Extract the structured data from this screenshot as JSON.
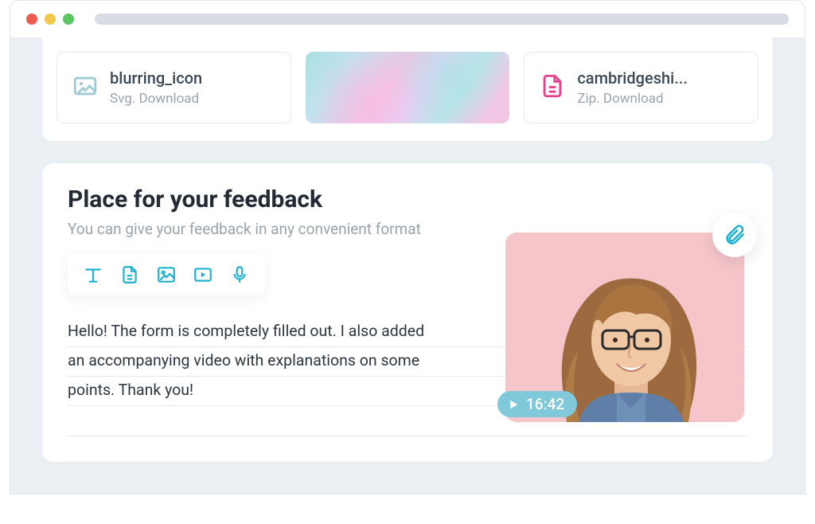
{
  "attachments": [
    {
      "title": "blurring_icon",
      "subtitle": "Svg. Download",
      "icon_color": "#9fcad4"
    },
    {
      "title": "cambridgeshi...",
      "subtitle": "Zip. Download",
      "icon_color": "#e83e8c"
    }
  ],
  "feedback": {
    "title": "Place for your feedback",
    "subtitle": "You can give your feedback in any convenient format",
    "text_lines": [
      "Hello! The form is completely filled out. I also added",
      "an accompanying video with explanations on some",
      "points. Thank you!"
    ]
  },
  "video": {
    "duration": "16:42"
  }
}
